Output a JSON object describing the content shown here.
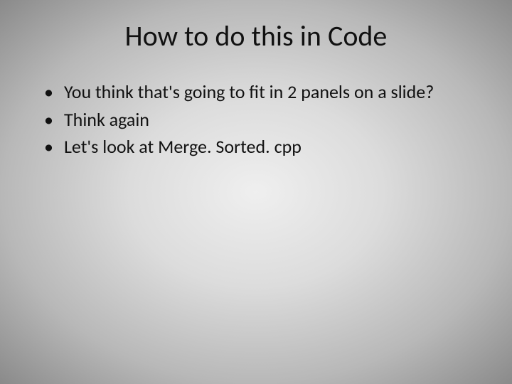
{
  "slide": {
    "title": "How to do this in Code",
    "bullets": [
      "You think that's going to fit in 2 panels on a slide?",
      "Think again",
      "Let's look at Merge. Sorted. cpp"
    ]
  }
}
